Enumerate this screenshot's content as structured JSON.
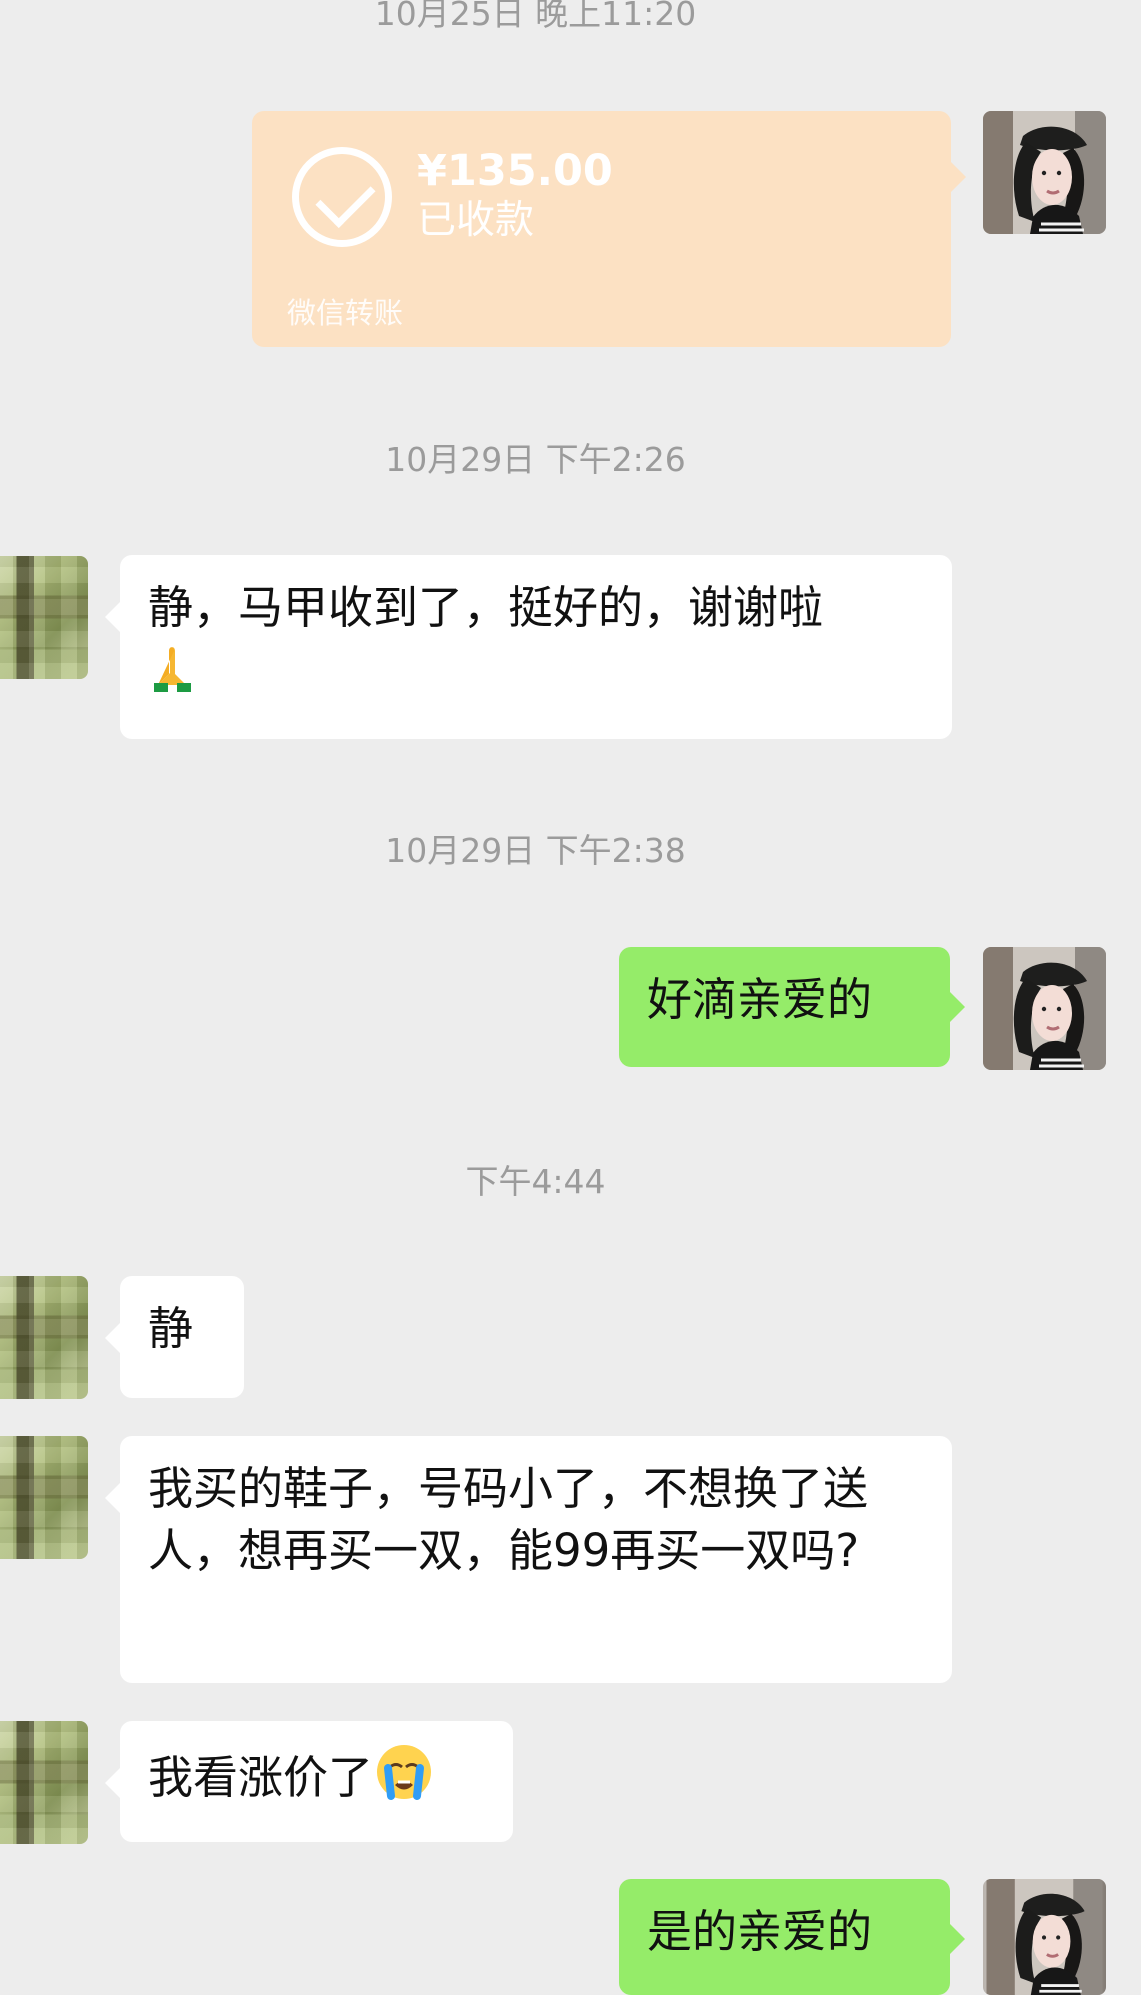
{
  "timestamps": {
    "t1": "10月25日 晚上11:20",
    "t2": "10月29日 下午2:26",
    "t3": "10月29日 下午2:38",
    "t4": "下午4:44"
  },
  "transfer": {
    "amount": "¥135.00",
    "status": "已收款",
    "footer": "微信转账"
  },
  "messages": {
    "m1": "静，马甲收到了，挺好的，谢谢啦",
    "m2": "好滴亲爱的",
    "m3": "静",
    "m4": "我买的鞋子，号码小了，不想换了送人，想再买一双，能99再买一双吗?",
    "m5": "我看涨价了",
    "m6": "是的亲爱的"
  },
  "emoji": {
    "m1": "folded-hands-emoji",
    "m5": "crying-face-emoji"
  },
  "colors": {
    "background": "#ededed",
    "incoming_bubble": "#ffffff",
    "outgoing_bubble": "#95ec69",
    "transfer_bubble": "#fce1c3",
    "timestamp_text": "#9b9b9b"
  }
}
